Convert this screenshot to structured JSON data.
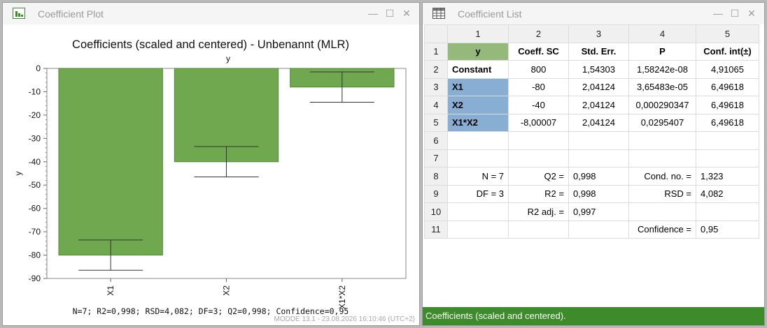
{
  "left_window": {
    "title": "Coefficient Plot",
    "footer": "N=7; R2=0,998; RSD=4,082; DF=3; Q2=0,998; Confidence=0,95",
    "stamp": "MODDE 13.1 - 23.08.2026 16:10:46 (UTC+2)"
  },
  "right_window": {
    "title": "Coefficient List",
    "status": "Coefficients (scaled and centered).",
    "col_headers": [
      "1",
      "2",
      "3",
      "4",
      "5"
    ],
    "rows": [
      {
        "n": "1",
        "c": [
          "y",
          "Coeff. SC",
          "Std. Err.",
          "P",
          "Conf. int(±)"
        ]
      },
      {
        "n": "2",
        "c": [
          "Constant",
          "800",
          "1,54303",
          "1,58242e-08",
          "4,91065"
        ]
      },
      {
        "n": "3",
        "c": [
          "X1",
          "-80",
          "2,04124",
          "3,65483e-05",
          "6,49618"
        ]
      },
      {
        "n": "4",
        "c": [
          "X2",
          "-40",
          "2,04124",
          "0,000290347",
          "6,49618"
        ]
      },
      {
        "n": "5",
        "c": [
          "X1*X2",
          "-8,00007",
          "2,04124",
          "0,0295407",
          "6,49618"
        ]
      },
      {
        "n": "6",
        "c": [
          "",
          "",
          "",
          "",
          ""
        ]
      },
      {
        "n": "7",
        "c": [
          "",
          "",
          "",
          "",
          ""
        ]
      },
      {
        "n": "8",
        "c": [
          "N = 7",
          "Q2 =",
          "0,998",
          "Cond. no. =",
          "1,323"
        ]
      },
      {
        "n": "9",
        "c": [
          "DF = 3",
          "R2 =",
          "0,998",
          "RSD =",
          "4,082"
        ]
      },
      {
        "n": "10",
        "c": [
          "",
          "R2 adj. =",
          "0,997",
          "",
          ""
        ]
      },
      {
        "n": "11",
        "c": [
          "",
          "",
          "",
          "Confidence =",
          "0,95"
        ]
      }
    ]
  },
  "colors": {
    "bar": "#6fa84e",
    "bar_edge": "#4f8a35",
    "status": "#3d8b2b",
    "selected_blue": "#88aed4",
    "selected_green": "#94b97b"
  },
  "chart_data": {
    "type": "bar",
    "title": "Coefficients (scaled and centered) - Unbenannt (MLR)",
    "subtitle": "y",
    "ylabel": "y",
    "categories": [
      "X1",
      "X2",
      "X1*X2"
    ],
    "values": [
      -80,
      -40,
      -8.00007
    ],
    "errors": [
      6.49618,
      6.49618,
      6.49618
    ],
    "ylim": [
      -90,
      0
    ],
    "yticks": [
      0,
      -10,
      -20,
      -30,
      -40,
      -50,
      -60,
      -70,
      -80,
      -90
    ]
  }
}
